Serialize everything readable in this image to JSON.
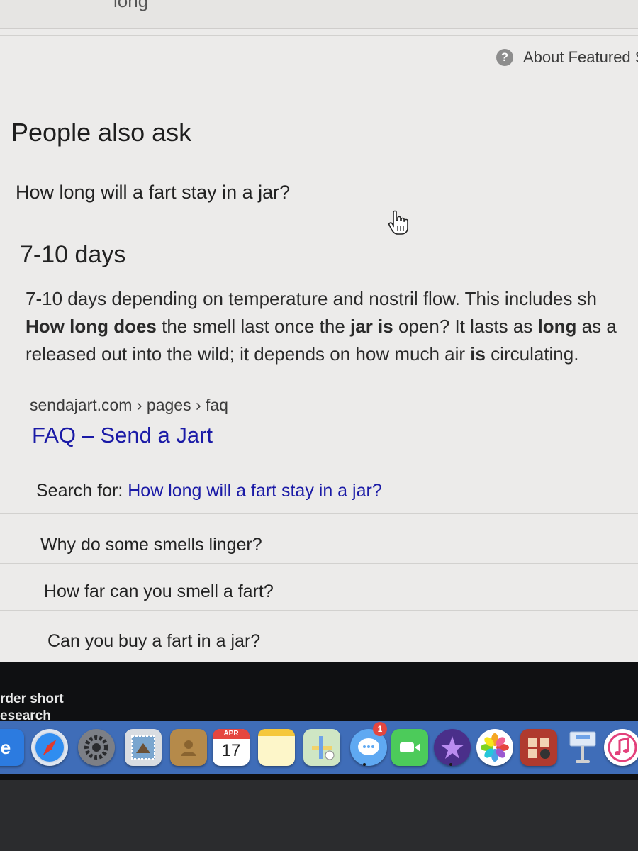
{
  "top": {
    "clipped_text": "long"
  },
  "header": {
    "about_label": "About Featured S"
  },
  "paa": {
    "title": "People also ask",
    "question": "How long will a fart stay in a jar?",
    "answer_title": "7-10 days",
    "snippet": {
      "line1": "7-10 days depending on temperature and nostril flow. This includes sh",
      "line2_b1": "How long does",
      "line2_t1": " the smell last once the ",
      "line2_b2": "jar is",
      "line2_t2": " open? It lasts as ",
      "line2_b3": "long",
      "line2_t3": " as a",
      "line3_t1": "released out into the wild; it depends on how much air ",
      "line3_b1": "is",
      "line3_t2": " circulating."
    },
    "cite": "sendajart.com › pages › faq",
    "link_title": "FAQ – Send a Jart",
    "search_for_label": "Search for: ",
    "search_for_query": "How long will a fart stay in a jar?",
    "related": [
      "Why do some smells linger?",
      "How far can you smell a fart?",
      "Can you buy a fart in a jar?"
    ]
  },
  "desktop": {
    "line1": "rder short",
    "line2": "esearch"
  },
  "dock": {
    "calendar_month": "APR",
    "calendar_day": "17",
    "messages_badge": "1",
    "icons": [
      "ie-icon",
      "safari-icon",
      "system-preferences-icon",
      "mail-icon",
      "contacts-icon",
      "calendar-icon",
      "notes-icon",
      "maps-icon",
      "messages-icon",
      "facetime-icon",
      "imovie-icon",
      "photos-icon",
      "photo-booth-icon",
      "keynote-icon",
      "itunes-icon"
    ]
  },
  "colors": {
    "link": "#1a1aa6",
    "dock": "#3f6db8",
    "page_bg": "#ecebea"
  }
}
